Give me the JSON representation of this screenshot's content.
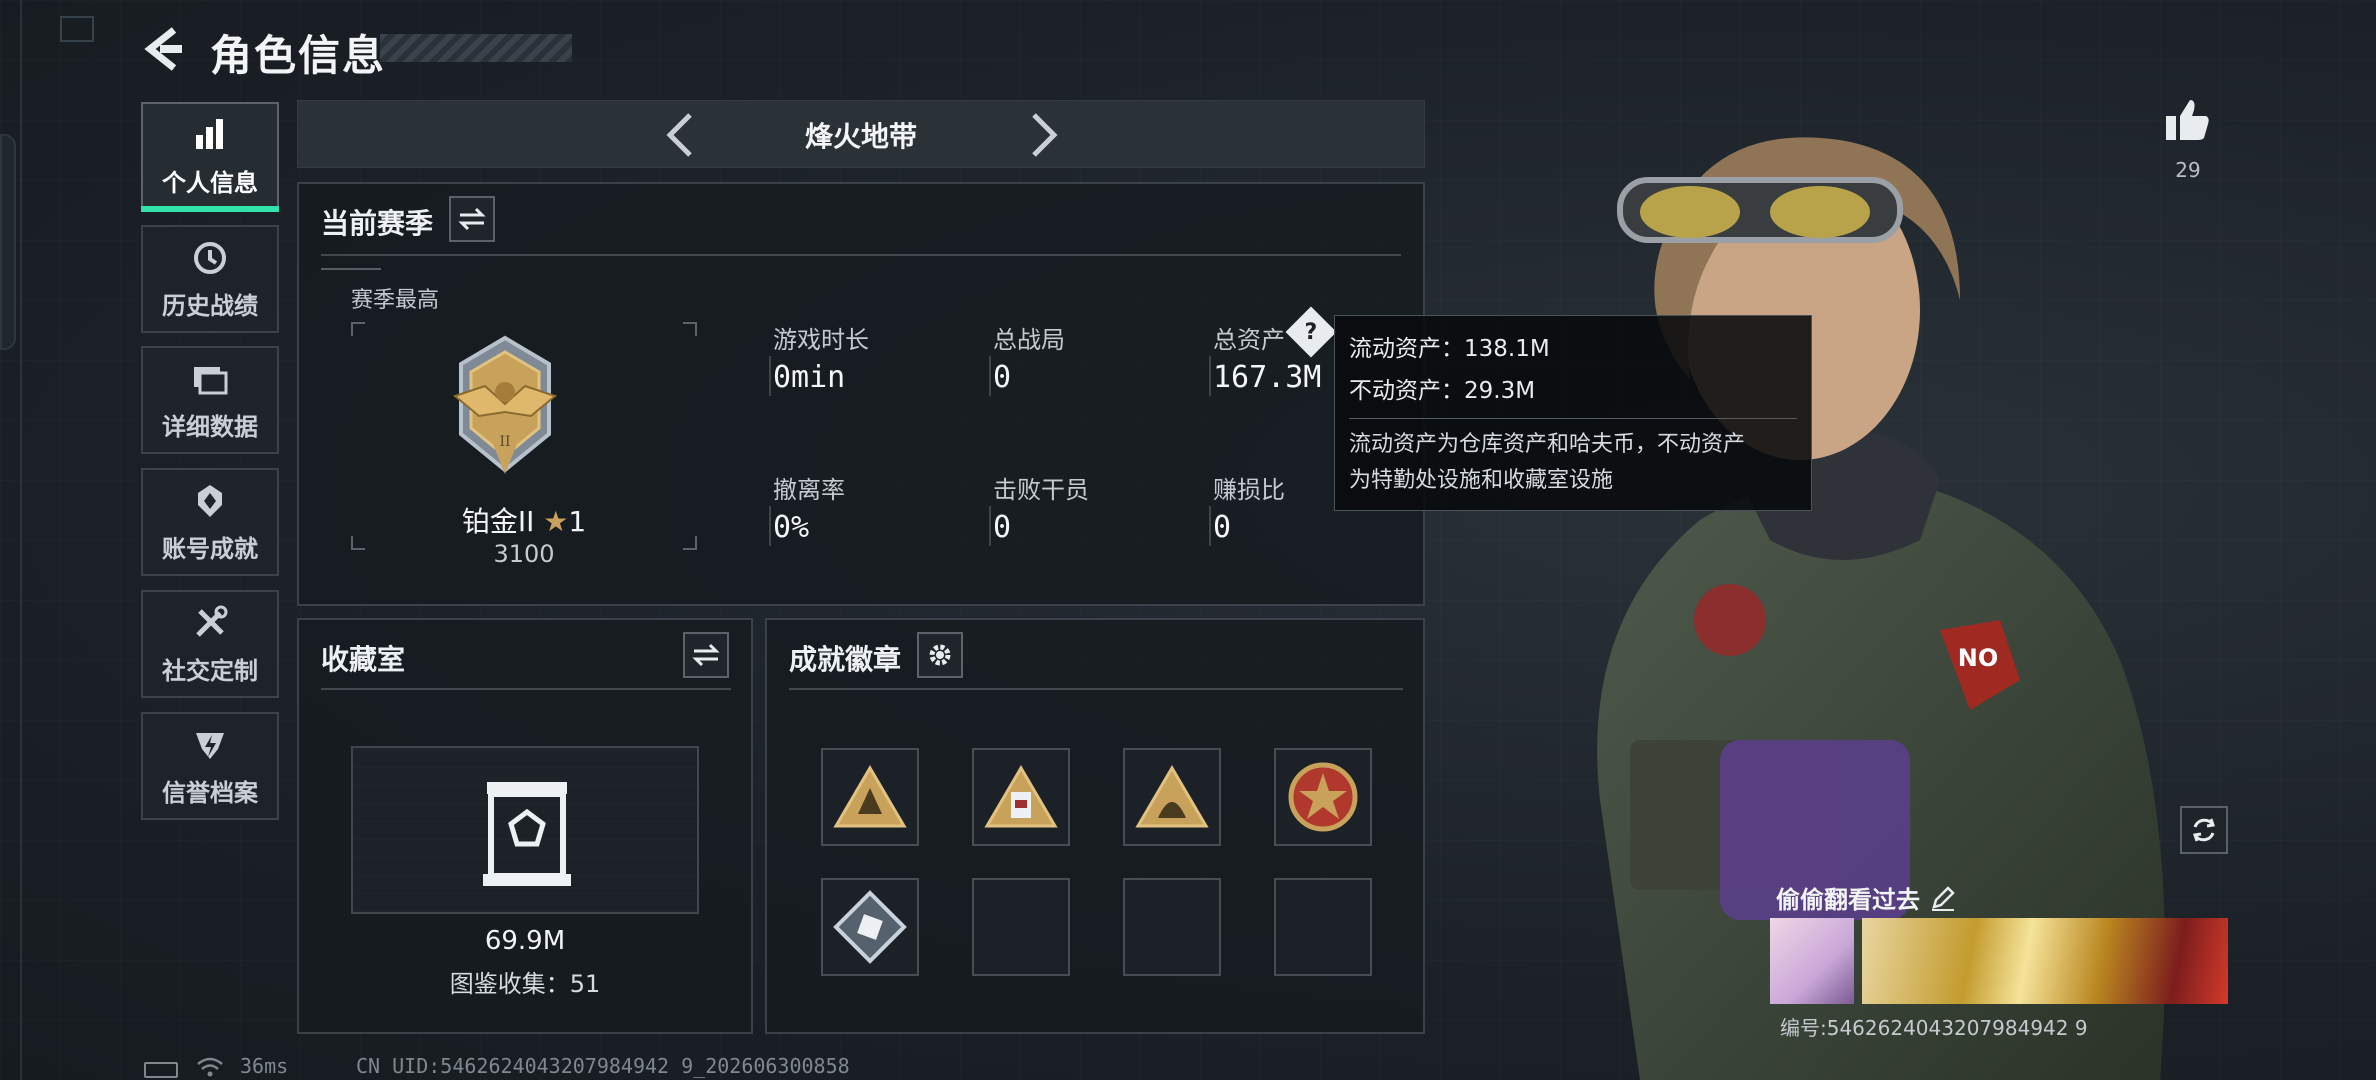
{
  "header": {
    "title": "角色信息"
  },
  "nav": {
    "items": [
      {
        "label": "个人信息"
      },
      {
        "label": "历史战绩"
      },
      {
        "label": "详细数据"
      },
      {
        "label": "账号成就"
      },
      {
        "label": "社交定制"
      },
      {
        "label": "信誉档案"
      }
    ]
  },
  "map": {
    "title": "烽火地带"
  },
  "season": {
    "title": "当前赛季",
    "best_label": "赛季最高",
    "rank_name": "铂金II",
    "rank_stars": "1",
    "rank_points": "3100",
    "stats": [
      {
        "label": "游戏时长",
        "value": "0min"
      },
      {
        "label": "总战局",
        "value": "0"
      },
      {
        "label": "总资产",
        "value": "167.3M"
      },
      {
        "label": "撤离率",
        "value": "0%"
      },
      {
        "label": "击败干员",
        "value": "0"
      },
      {
        "label": "赚损比",
        "value": "0"
      }
    ]
  },
  "tooltip": {
    "liquid": "流动资产：138.1M",
    "fixed": "不动资产：29.3M",
    "desc_line1": "流动资产为仓库资产和哈夫币，不动资产",
    "desc_line2": "为特勤处设施和收藏室设施"
  },
  "collection": {
    "title": "收藏室",
    "value": "69.9M",
    "codex": "图鉴收集：51"
  },
  "achievements": {
    "title": "成就徽章"
  },
  "profile": {
    "likes": "29",
    "signature": "偷偷翻看过去",
    "serial": "编号:5462624043207984942 9"
  },
  "footer": {
    "ping": "36ms",
    "uid": "CN UID:5462624043207984942 9_202606300858"
  },
  "colors": {
    "accent": "#33e2a9",
    "panel_border": "#3a4148",
    "gold": "#c8a15a"
  }
}
